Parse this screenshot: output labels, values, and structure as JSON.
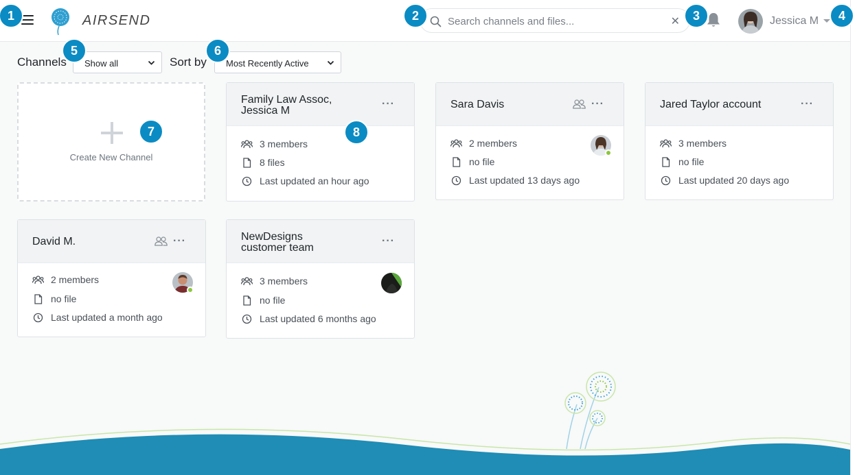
{
  "app": {
    "logo_text": "AIRSEND"
  },
  "search": {
    "placeholder": "Search channels and files...",
    "clear_glyph": "✕"
  },
  "user": {
    "name": "Jessica M"
  },
  "filters": {
    "channels_label": "Channels",
    "channels_value": "Show all",
    "sort_label": "Sort by",
    "sort_value": "Most Recently Active"
  },
  "create_channel": {
    "label": "Create New Channel"
  },
  "badges": [
    "1",
    "2",
    "3",
    "4",
    "5",
    "6",
    "7",
    "8"
  ],
  "channels": [
    {
      "title_line1": "Family Law Assoc,",
      "title_line2": "Jessica M",
      "members": "3 members",
      "files": "8 files",
      "updated": "Last updated an hour ago"
    },
    {
      "title": "Sara Davis",
      "members": "2 members",
      "files": "no file",
      "updated": "Last updated 13 days ago"
    },
    {
      "title": "Jared Taylor account",
      "members": "3 members",
      "files": "no file",
      "updated": "Last updated 20 days ago"
    },
    {
      "title": "David M.",
      "members": "2 members",
      "files": "no file",
      "updated": "Last updated a month ago"
    },
    {
      "title_line1": "NewDesigns",
      "title_line2": "customer team",
      "members": "3 members",
      "files": "no file",
      "updated": "Last updated 6 months ago"
    }
  ],
  "menu_glyph": "···",
  "colors": {
    "accent": "#0b8bc3",
    "online": "#8cc63f",
    "wave": "#1f8db5"
  },
  "icons": [
    "menu-icon",
    "dandelion-logo-icon",
    "search-icon",
    "clear-icon",
    "bell-icon",
    "caret-down-icon",
    "chevron-down-icon",
    "plus-icon",
    "members-icon",
    "file-icon",
    "clock-icon",
    "people-icon",
    "more-icon"
  ]
}
